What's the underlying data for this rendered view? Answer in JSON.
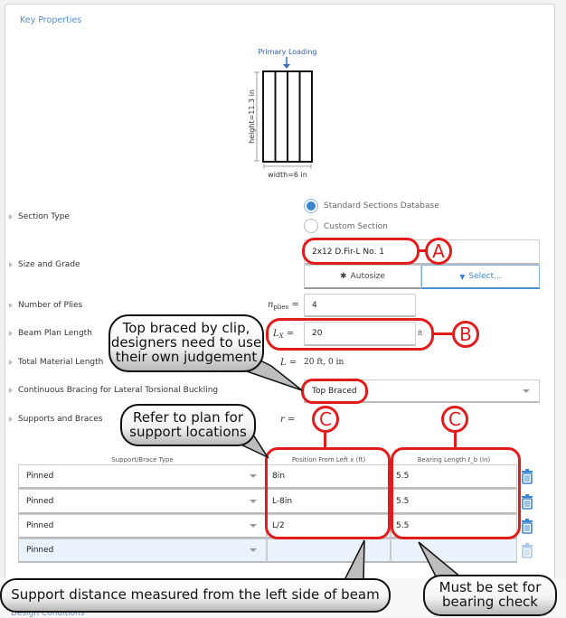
{
  "panel": {
    "title": "Key Properties"
  },
  "diagram": {
    "loading_label": "Primary Loading",
    "height_label": "height=11.3 in",
    "width_label": "width=6 in",
    "plies": 4
  },
  "rows": {
    "section_type": "Section Type",
    "size_grade": "Size and Grade",
    "plies": "Number of Plies",
    "plan_length": "Beam Plan Length",
    "material_length": "Total Material Length",
    "bracing": "Continuous Bracing for Lateral Torsional Buckling",
    "supports": "Supports and Braces"
  },
  "section_type": {
    "options": [
      "Standard Sections Database",
      "Custom Section"
    ],
    "selected": "Standard Sections Database"
  },
  "size_grade": {
    "value": "2x12 D.Fir-L No. 1",
    "autosize_label": "Autosize",
    "select_label": "Select...",
    "autosize_icon": "magic-wand-icon",
    "select_icon": "filter-icon"
  },
  "plies": {
    "symbol": "n",
    "sub": "plies",
    "eq": "=",
    "value": "4"
  },
  "plan_length": {
    "symbol": "L",
    "sub": "X",
    "eq": "=",
    "value": "20",
    "unit": "ft"
  },
  "material_length": {
    "symbol": "L",
    "eq": "=",
    "value": "20 ft, 0 in"
  },
  "bracing": {
    "value": "Top Braced"
  },
  "supports": {
    "symbol": "r",
    "eq": "=",
    "headers": {
      "type": "Support/Brace Type",
      "position": "Position From Left x (ft)",
      "bearing": "Bearing Length ℓ_b (in)"
    },
    "rows": [
      {
        "type": "Pinned",
        "position": "8in",
        "bearing": "5.5"
      },
      {
        "type": "Pinned",
        "position": "L-8in",
        "bearing": "5.5"
      },
      {
        "type": "Pinned",
        "position": "L/2",
        "bearing": "5.5"
      },
      {
        "type": "Pinned",
        "position": "",
        "bearing": ""
      }
    ]
  },
  "annotations": {
    "markers": [
      "A",
      "B",
      "C",
      "C"
    ],
    "callouts": {
      "top_braced": "Top braced by clip, designers need to use their own judgement",
      "refer_plan": "Refer to plan for support locations",
      "support_distance": "Support distance measured from the left side of beam",
      "bearing": "Must be set for bearing check"
    }
  },
  "next_section": {
    "title": "Design Conditions"
  }
}
